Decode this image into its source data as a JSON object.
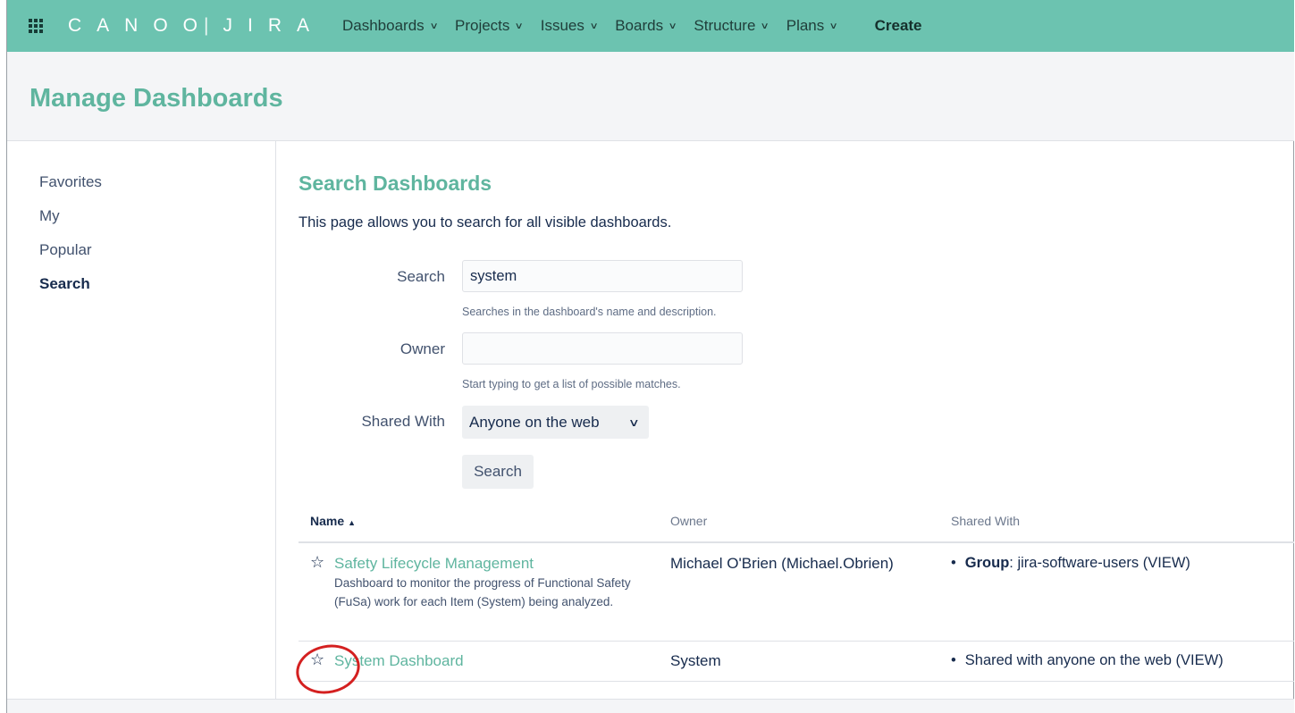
{
  "nav": {
    "logo_left": "CANOO",
    "logo_sep": "|",
    "logo_right": "JIRA",
    "items": [
      {
        "label": "Dashboards"
      },
      {
        "label": "Projects"
      },
      {
        "label": "Issues"
      },
      {
        "label": "Boards"
      },
      {
        "label": "Structure"
      },
      {
        "label": "Plans"
      }
    ],
    "create_label": "Create"
  },
  "header": {
    "title": "Manage Dashboards"
  },
  "sidebar": {
    "items": [
      {
        "label": "Favorites"
      },
      {
        "label": "My"
      },
      {
        "label": "Popular"
      },
      {
        "label": "Search",
        "active": true
      }
    ]
  },
  "main": {
    "section_title": "Search Dashboards",
    "intro": "This page allows you to search for all visible dashboards.",
    "search_label": "Search",
    "search_value": "system",
    "search_hint": "Searches in the dashboard's name and description.",
    "owner_label": "Owner",
    "owner_value": "",
    "owner_hint": "Start typing to get a list of possible matches.",
    "shared_label": "Shared With",
    "shared_value": "Anyone on the web",
    "search_button": "Search"
  },
  "table": {
    "headers": {
      "name": "Name",
      "owner": "Owner",
      "shared": "Shared With"
    },
    "rows": [
      {
        "name": "Safety Lifecycle Management",
        "description": "Dashboard to monitor the progress of Functional Safety (FuSa) work for each Item (System) being analyzed.",
        "owner": "Michael O'Brien (Michael.Obrien)",
        "shared_bold": "Group",
        "shared_text": ": jira-software-users (VIEW)"
      },
      {
        "name": "System Dashboard",
        "description": "",
        "owner": "System",
        "shared_bold": "",
        "shared_text": "Shared with anyone on the web (VIEW)"
      }
    ]
  },
  "colors": {
    "nav_bg": "#6cc3b0",
    "accent": "#5fb59f",
    "annotation": "#d42020"
  }
}
